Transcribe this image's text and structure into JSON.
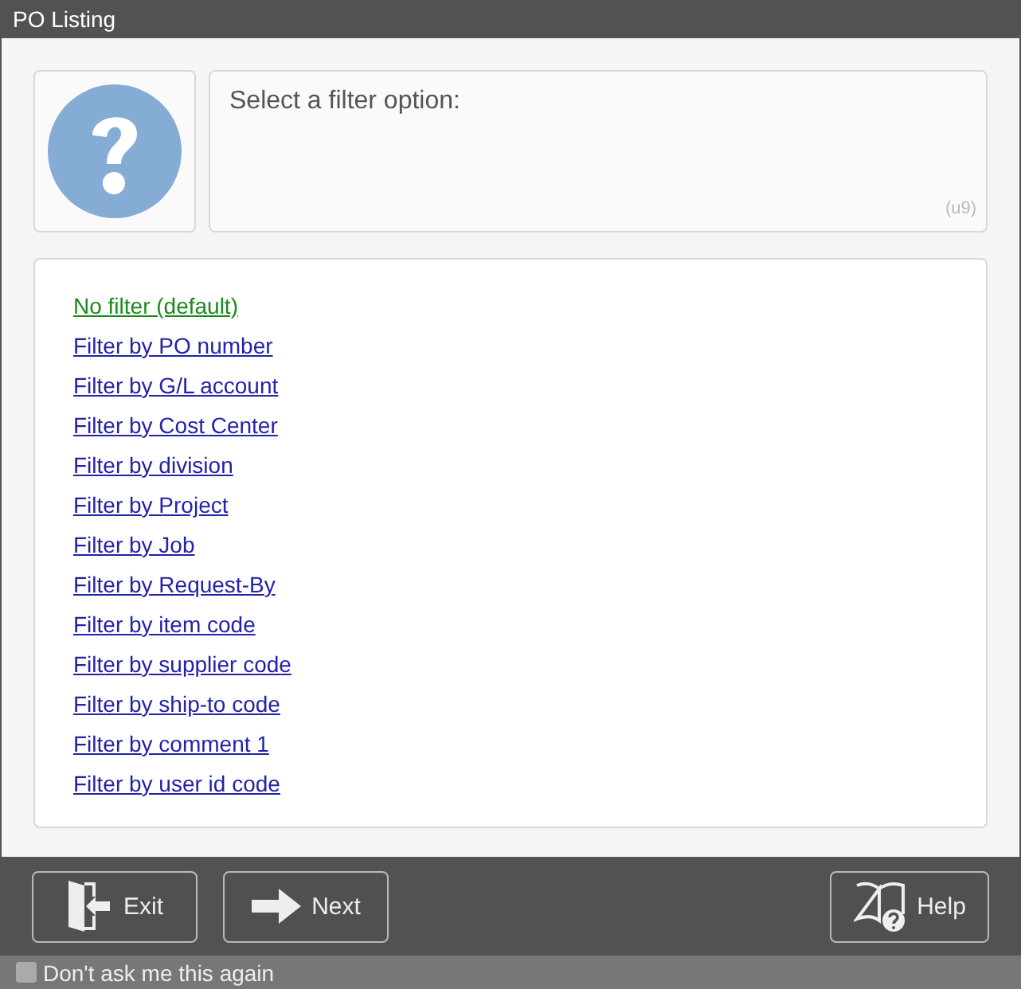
{
  "window": {
    "title": "PO Listing"
  },
  "message": {
    "text": "Select a filter option:",
    "code": "(u9)"
  },
  "options": [
    {
      "label": "No filter (default)",
      "selected": true
    },
    {
      "label": "Filter by PO number",
      "selected": false
    },
    {
      "label": "Filter by G/L account",
      "selected": false
    },
    {
      "label": "Filter by Cost Center",
      "selected": false
    },
    {
      "label": "Filter by division",
      "selected": false
    },
    {
      "label": "Filter by Project",
      "selected": false
    },
    {
      "label": "Filter by Job",
      "selected": false
    },
    {
      "label": "Filter by Request-By",
      "selected": false
    },
    {
      "label": "Filter by item code",
      "selected": false
    },
    {
      "label": "Filter by supplier code",
      "selected": false
    },
    {
      "label": "Filter by ship-to code",
      "selected": false
    },
    {
      "label": "Filter by comment 1",
      "selected": false
    },
    {
      "label": "Filter by user id code",
      "selected": false
    }
  ],
  "buttons": [
    {
      "kind": "exit",
      "label": "Exit"
    },
    {
      "kind": "next",
      "label": "Next"
    },
    {
      "kind": "help",
      "label": "Help"
    }
  ],
  "dont_ask": {
    "label": "Don't ask me this again",
    "checked": false
  }
}
